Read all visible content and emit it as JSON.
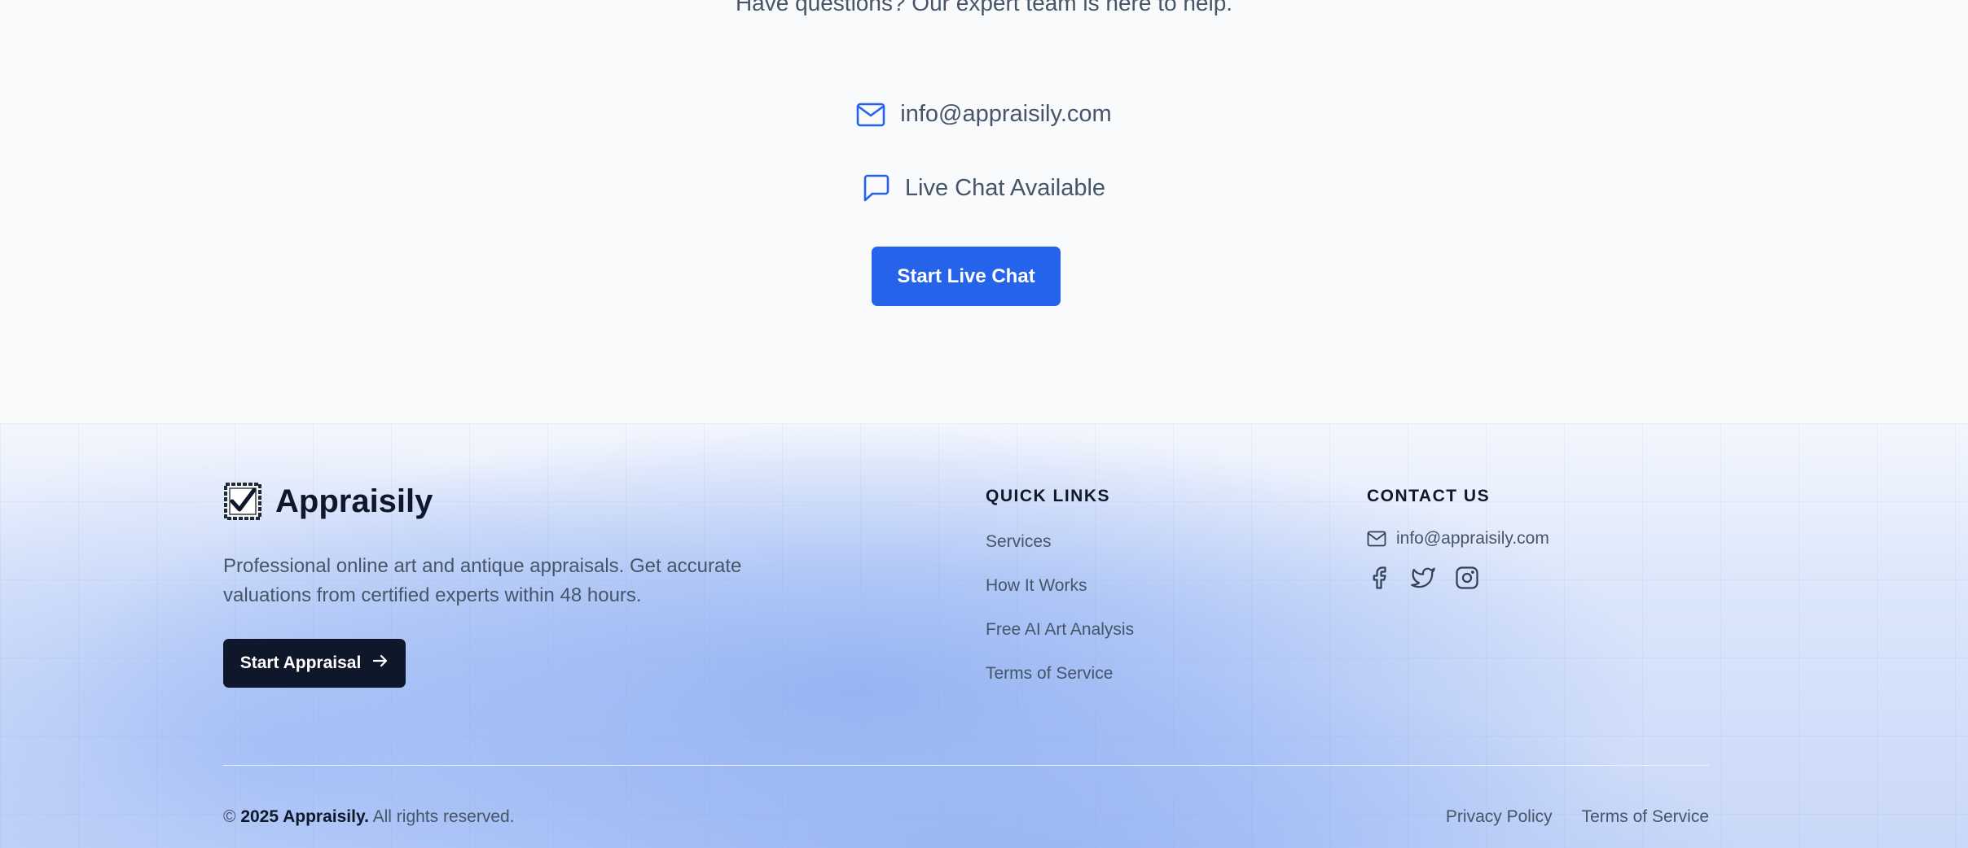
{
  "contact": {
    "subtitle": "Have questions? Our expert team is here to help.",
    "email": "info@appraisily.com",
    "chat_label": "Live Chat Available",
    "chat_button": "Start Live Chat",
    "email_icon": "mail-icon",
    "chat_icon": "message-square-icon",
    "accent_color": "#2563eb"
  },
  "footer": {
    "brand": {
      "name": "Appraisily",
      "logo_icon": "checkbox-logo-icon"
    },
    "tagline": "Professional online art and antique appraisals. Get accurate valuations from certified experts within 48 hours.",
    "cta_label": "Start Appraisal",
    "cta_icon": "arrow-right-icon",
    "quick_links": {
      "heading": "QUICK LINKS",
      "items": [
        "Services",
        "How It Works",
        "Free AI Art Analysis",
        "Terms of Service"
      ]
    },
    "contact_us": {
      "heading": "CONTACT US",
      "email": "info@appraisily.com",
      "socials": [
        "facebook-icon",
        "twitter-icon",
        "instagram-icon"
      ]
    },
    "copyright": {
      "symbol": "©",
      "owner": "2025 Appraisily.",
      "rights": "All rights reserved."
    },
    "legal_links": [
      "Privacy Policy",
      "Terms of Service"
    ]
  }
}
